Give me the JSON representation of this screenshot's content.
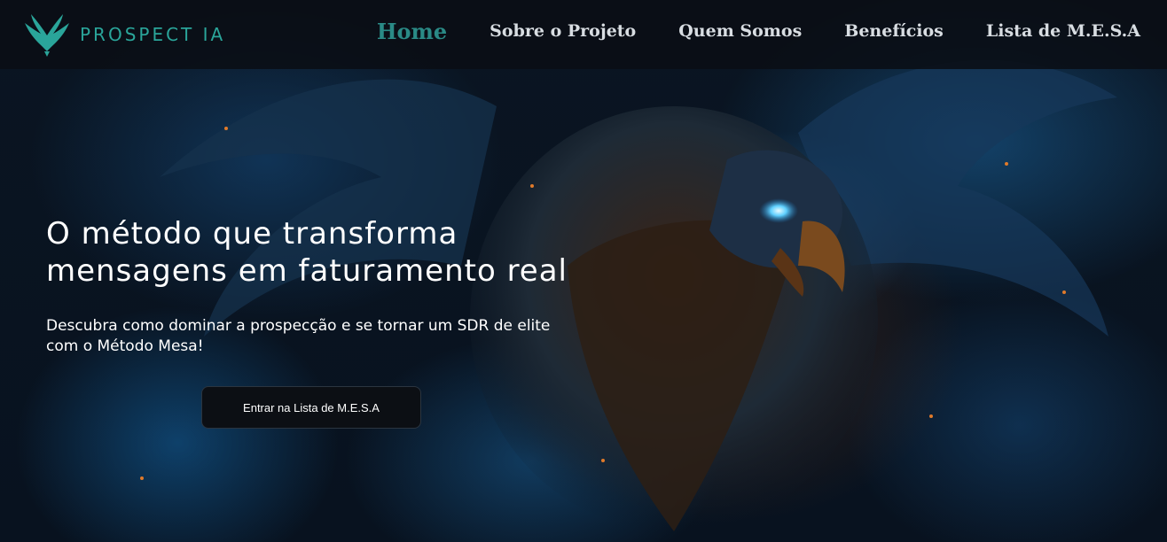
{
  "brand": {
    "name": "PROSPECT IA",
    "accent": "#2aa59a"
  },
  "nav": {
    "items": [
      {
        "label": "Home",
        "active": true
      },
      {
        "label": "Sobre o Projeto",
        "active": false
      },
      {
        "label": "Quem Somos",
        "active": false
      },
      {
        "label": "Benefícios",
        "active": false
      },
      {
        "label": "Lista de M.E.S.A",
        "active": false
      }
    ]
  },
  "hero": {
    "title": "O método que transforma mensagens em faturamento real",
    "subtitle": "Descubra como dominar a prospecção e se tornar um SDR de elite com o Método Mesa!",
    "cta_label": "Entrar na Lista de M.E.S.A",
    "background": "phoenix-illustration"
  }
}
